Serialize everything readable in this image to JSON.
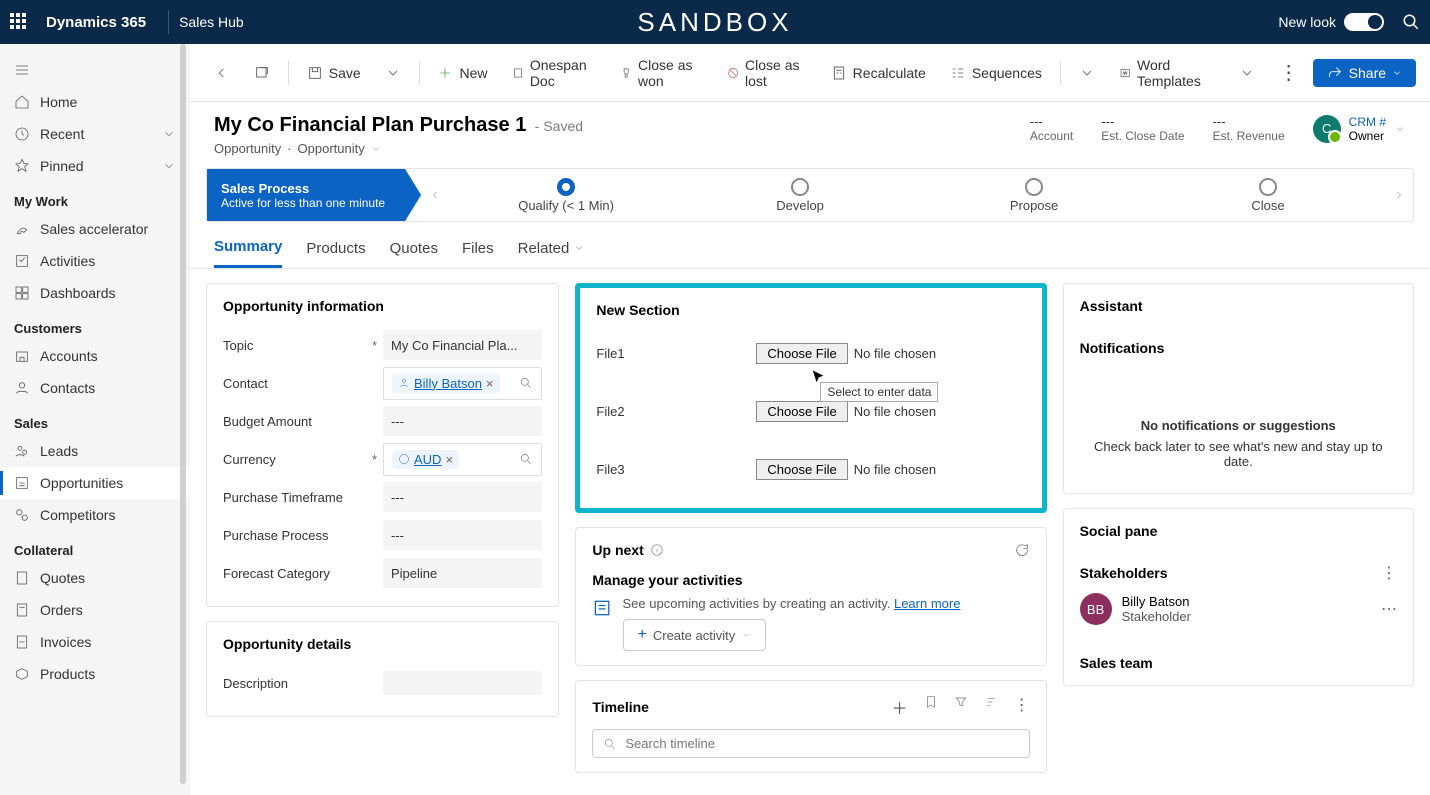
{
  "topbar": {
    "app": "Dynamics 365",
    "module": "Sales Hub",
    "sandbox": "SANDBOX",
    "newlook": "New look"
  },
  "nav": {
    "items1": [
      {
        "label": "Home"
      },
      {
        "label": "Recent",
        "chev": true
      },
      {
        "label": "Pinned",
        "chev": true
      }
    ],
    "section_mywork": "My Work",
    "items2": [
      {
        "label": "Sales accelerator"
      },
      {
        "label": "Activities"
      },
      {
        "label": "Dashboards"
      }
    ],
    "section_customers": "Customers",
    "items3": [
      {
        "label": "Accounts"
      },
      {
        "label": "Contacts"
      }
    ],
    "section_sales": "Sales",
    "items4": [
      {
        "label": "Leads"
      },
      {
        "label": "Opportunities",
        "active": true
      },
      {
        "label": "Competitors"
      }
    ],
    "section_collateral": "Collateral",
    "items5": [
      {
        "label": "Quotes"
      },
      {
        "label": "Orders"
      },
      {
        "label": "Invoices"
      },
      {
        "label": "Products"
      }
    ]
  },
  "cmd": {
    "save": "Save",
    "new": "New",
    "onespan": "Onespan Doc",
    "close_won": "Close as won",
    "close_lost": "Close as lost",
    "recalc": "Recalculate",
    "sequences": "Sequences",
    "word_tmpl": "Word Templates",
    "share": "Share"
  },
  "header": {
    "title": "My Co Financial Plan Purchase 1",
    "saved": "- Saved",
    "sub1": "Opportunity",
    "sub2": "Opportunity",
    "meta": [
      {
        "val": "---",
        "lbl": "Account"
      },
      {
        "val": "---",
        "lbl": "Est. Close Date"
      },
      {
        "val": "---",
        "lbl": "Est. Revenue"
      }
    ],
    "owner_initial": "C",
    "owner_name": "CRM #",
    "owner_role": "Owner"
  },
  "bpf": {
    "name": "Sales Process",
    "sub": "Active for less than one minute",
    "stages": [
      {
        "label": "Qualify  (< 1 Min)",
        "current": true
      },
      {
        "label": "Develop"
      },
      {
        "label": "Propose"
      },
      {
        "label": "Close"
      }
    ]
  },
  "tabs": [
    "Summary",
    "Products",
    "Quotes",
    "Files",
    "Related"
  ],
  "opp_info": {
    "title": "Opportunity information",
    "fields": {
      "topic_lbl": "Topic",
      "topic_val": "My Co Financial Pla...",
      "contact_lbl": "Contact",
      "contact_val": "Billy Batson",
      "budget_lbl": "Budget Amount",
      "budget_val": "---",
      "currency_lbl": "Currency",
      "currency_val": "AUD",
      "timeframe_lbl": "Purchase Timeframe",
      "timeframe_val": "---",
      "process_lbl": "Purchase Process",
      "process_val": "---",
      "forecast_lbl": "Forecast Category",
      "forecast_val": "Pipeline"
    }
  },
  "opp_details": {
    "title": "Opportunity details",
    "desc_lbl": "Description"
  },
  "new_section": {
    "title": "New Section",
    "files": [
      {
        "lbl": "File1",
        "btn": "Choose File",
        "status": "No file chosen"
      },
      {
        "lbl": "File2",
        "btn": "Choose File",
        "status": "No file chosen"
      },
      {
        "lbl": "File3",
        "btn": "Choose File",
        "status": "No file chosen"
      }
    ],
    "tooltip": "Select to enter data"
  },
  "upnext": {
    "title": "Up next",
    "sub": "Manage your activities",
    "text": "See upcoming activities by creating an activity. ",
    "learn": "Learn more",
    "btn": "Create activity"
  },
  "timeline": {
    "title": "Timeline",
    "search": "Search timeline"
  },
  "assistant": {
    "title": "Assistant"
  },
  "notifications": {
    "title": "Notifications",
    "msg1": "No notifications or suggestions",
    "msg2": "Check back later to see what's new and stay up to date."
  },
  "social": {
    "title": "Social pane",
    "stake_title": "Stakeholders",
    "person": "Billy Batson",
    "role": "Stakeholder",
    "initials": "BB",
    "sales_team": "Sales team"
  }
}
